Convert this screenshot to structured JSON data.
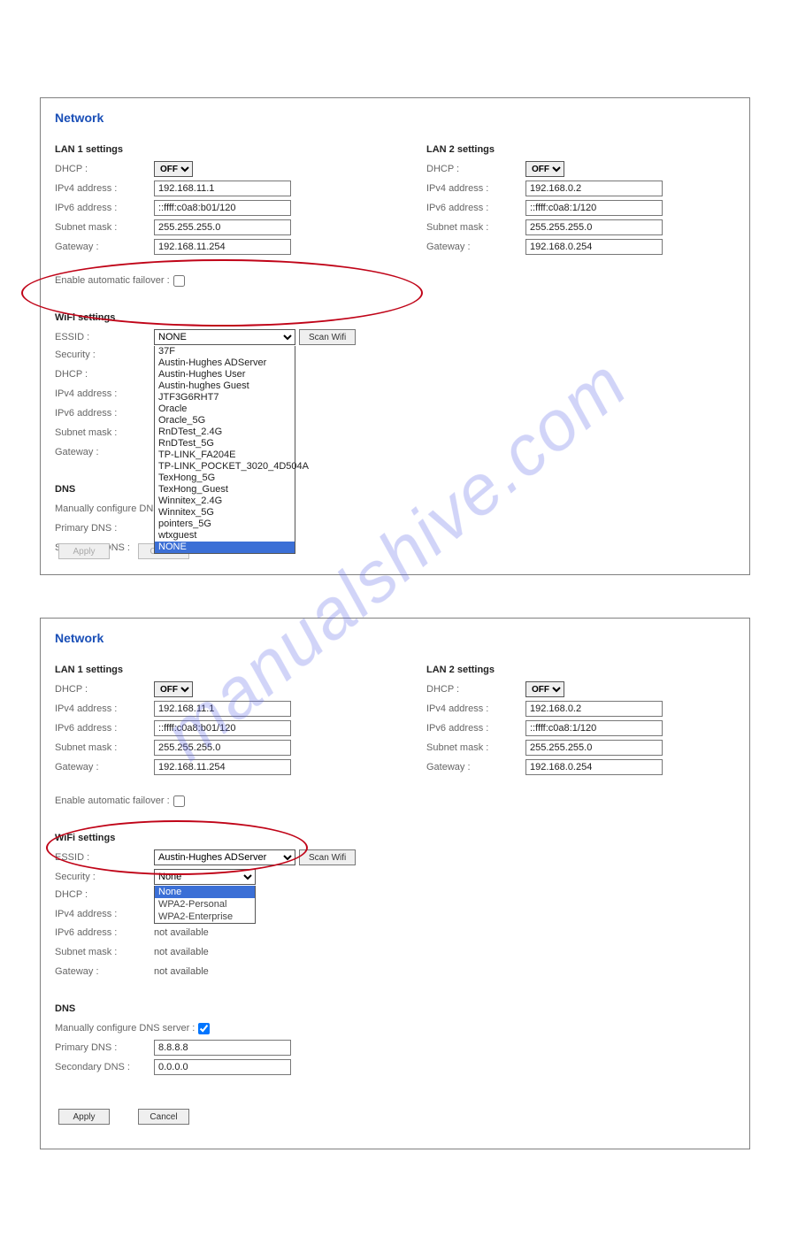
{
  "watermark": "manualshive.com",
  "panel1": {
    "title": "Network",
    "lan1": {
      "heading": "LAN 1 settings",
      "dhcp_label": "DHCP :",
      "dhcp_value": "OFF",
      "ipv4_label": "IPv4 address :",
      "ipv4_value": "192.168.11.1",
      "ipv6_label": "IPv6 address :",
      "ipv6_value": "::ffff:c0a8:b01/120",
      "subnet_label": "Subnet mask :",
      "subnet_value": "255.255.255.0",
      "gateway_label": "Gateway :",
      "gateway_value": "192.168.11.254"
    },
    "lan2": {
      "heading": "LAN 2 settings",
      "dhcp_label": "DHCP :",
      "dhcp_value": "OFF",
      "ipv4_label": "IPv4 address :",
      "ipv4_value": "192.168.0.2",
      "ipv6_label": "IPv6 address :",
      "ipv6_value": "::ffff:c0a8:1/120",
      "subnet_label": "Subnet mask :",
      "subnet_value": "255.255.255.0",
      "gateway_label": "Gateway :",
      "gateway_value": "192.168.0.254"
    },
    "failover_label": "Enable automatic failover :",
    "wifi": {
      "heading": "WiFi settings",
      "essid_label": "ESSID :",
      "essid_value": "NONE",
      "scan_label": "Scan Wifi",
      "security_label": "Security :",
      "dhcp_label": "DHCP :",
      "ipv4_label": "IPv4 address :",
      "ipv6_label": "IPv6 address :",
      "subnet_label": "Subnet mask :",
      "gateway_label": "Gateway :",
      "options": [
        "37F",
        "Austin-Hughes ADServer",
        "Austin-Hughes User",
        "Austin-hughes Guest",
        "JTF3G6RHT7",
        "Oracle",
        "Oracle_5G",
        "RnDTest_2.4G",
        "RnDTest_5G",
        "TP-LINK_FA204E",
        "TP-LINK_POCKET_3020_4D504A",
        "TexHong_5G",
        "TexHong_Guest",
        "Winnitex_2.4G",
        "Winnitex_5G",
        "pointers_5G",
        "wtxguest",
        "NONE"
      ],
      "highlight_index": 17
    },
    "dns": {
      "heading": "DNS",
      "manual_label": "Manually configure DNS server :",
      "primary_label": "Primary DNS :",
      "secondary_label": "Secondary DNS :"
    },
    "apply_label": "Apply",
    "cancel_label": "Cancel"
  },
  "panel2": {
    "title": "Network",
    "lan1": {
      "heading": "LAN 1 settings",
      "dhcp_label": "DHCP :",
      "dhcp_value": "OFF",
      "ipv4_label": "IPv4 address :",
      "ipv4_value": "192.168.11.1",
      "ipv6_label": "IPv6 address :",
      "ipv6_value": "::ffff:c0a8:b01/120",
      "subnet_label": "Subnet mask :",
      "subnet_value": "255.255.255.0",
      "gateway_label": "Gateway :",
      "gateway_value": "192.168.11.254"
    },
    "lan2": {
      "heading": "LAN 2 settings",
      "dhcp_label": "DHCP :",
      "dhcp_value": "OFF",
      "ipv4_label": "IPv4 address :",
      "ipv4_value": "192.168.0.2",
      "ipv6_label": "IPv6 address :",
      "ipv6_value": "::ffff:c0a8:1/120",
      "subnet_label": "Subnet mask :",
      "subnet_value": "255.255.255.0",
      "gateway_label": "Gateway :",
      "gateway_value": "192.168.0.254"
    },
    "failover_label": "Enable automatic failover :",
    "wifi": {
      "heading": "WiFi settings",
      "essid_label": "ESSID :",
      "essid_value": "Austin-Hughes ADServer",
      "scan_label": "Scan Wifi",
      "security_label": "Security :",
      "security_value": "None",
      "security_options": [
        "None",
        "WPA2-Personal",
        "WPA2-Enterprise"
      ],
      "security_highlight_index": 0,
      "dhcp_label": "DHCP :",
      "ipv4_label": "IPv4 address :",
      "ipv6_label": "IPv6 address :",
      "ipv6_value": "not available",
      "subnet_label": "Subnet mask :",
      "subnet_value": "not available",
      "gateway_label": "Gateway :",
      "gateway_value": "not available"
    },
    "dns": {
      "heading": "DNS",
      "manual_label": "Manually configure DNS server :",
      "primary_label": "Primary DNS :",
      "primary_value": "8.8.8.8",
      "secondary_label": "Secondary DNS :",
      "secondary_value": "0.0.0.0"
    },
    "apply_label": "Apply",
    "cancel_label": "Cancel"
  }
}
